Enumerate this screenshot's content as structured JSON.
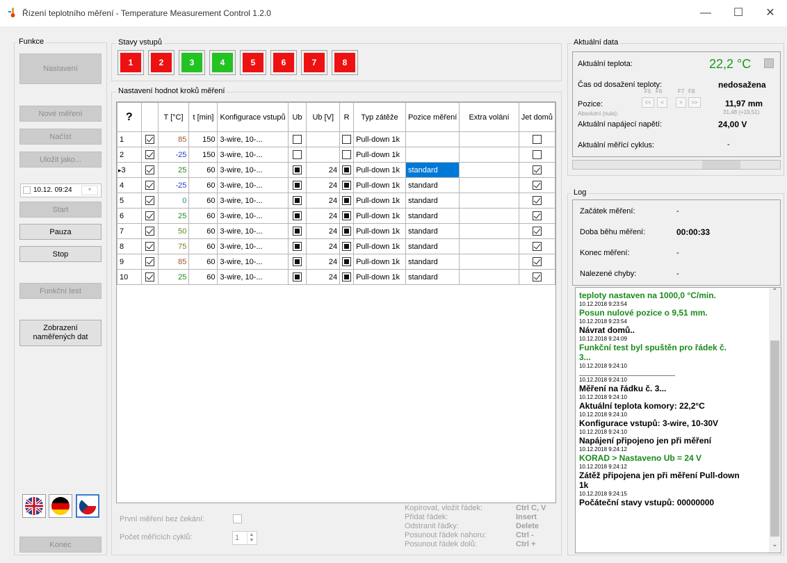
{
  "window": {
    "title": "Řízení teplotního měření - Temperature Measurement Control 1.2.0",
    "minimize": "—",
    "maximize": "☐",
    "close": "✕"
  },
  "funkce": {
    "title": "Funkce",
    "nastaveni": "Nastavení",
    "nove_mereni": "Nové měření",
    "nacist": "Načíst",
    "ulozit_jako": "Uložit jako...",
    "datetime_value": "10.12. 09:24",
    "start": "Start",
    "pauza": "Pauza",
    "stop": "Stop",
    "funkcni_test": "Funkční test",
    "zobrazeni_line1": "Zobrazení",
    "zobrazeni_line2": "naměřených dat",
    "konec": "Konec"
  },
  "stavy": {
    "title": "Stavy vstupů",
    "items": [
      {
        "label": "1",
        "color": "#ee1111"
      },
      {
        "label": "2",
        "color": "#ee1111"
      },
      {
        "label": "3",
        "color": "#22c322"
      },
      {
        "label": "4",
        "color": "#22c322"
      },
      {
        "label": "5",
        "color": "#ee1111"
      },
      {
        "label": "6",
        "color": "#ee1111"
      },
      {
        "label": "7",
        "color": "#ee1111"
      },
      {
        "label": "8",
        "color": "#ee1111"
      }
    ]
  },
  "kroky": {
    "title": "Nastavení hodnot kroků měření",
    "columns": [
      "?",
      "",
      "T [°C]",
      "t [min]",
      "Konfigurace vstupů",
      "Ub",
      "Ub [V]",
      "R",
      "Typ zátěže",
      "Pozice měření",
      "Extra volání",
      "Jet domů"
    ],
    "rows": [
      {
        "n": "1",
        "en": true,
        "t": "85",
        "tcol": "#a0522d",
        "min": "150",
        "konf": "3-wire, 10-...",
        "ub": "empty",
        "ubv": "",
        "r": "empty",
        "typ": "Pull-down 1k",
        "poz": "",
        "extra": "",
        "domu": "empty",
        "current": false
      },
      {
        "n": "2",
        "en": true,
        "t": "-25",
        "tcol": "#1f3fbf",
        "min": "150",
        "konf": "3-wire, 10-...",
        "ub": "empty",
        "ubv": "",
        "r": "empty",
        "typ": "Pull-down 1k",
        "poz": "",
        "extra": "",
        "domu": "empty",
        "current": false
      },
      {
        "n": "3",
        "en": true,
        "t": "25",
        "tcol": "#1a8a1a",
        "min": "60",
        "konf": "3-wire, 10-...",
        "ub": "ind",
        "ubv": "24",
        "r": "ind",
        "typ": "Pull-down 1k",
        "poz": "standard",
        "extra": "",
        "domu": "chk",
        "current": true
      },
      {
        "n": "4",
        "en": true,
        "t": "-25",
        "tcol": "#1f3fbf",
        "min": "60",
        "konf": "3-wire, 10-...",
        "ub": "ind",
        "ubv": "24",
        "r": "ind",
        "typ": "Pull-down 1k",
        "poz": "standard",
        "extra": "",
        "domu": "chk",
        "current": false
      },
      {
        "n": "5",
        "en": true,
        "t": "0",
        "tcol": "#1a8a8a",
        "min": "60",
        "konf": "3-wire, 10-...",
        "ub": "ind",
        "ubv": "24",
        "r": "ind",
        "typ": "Pull-down 1k",
        "poz": "standard",
        "extra": "",
        "domu": "chk",
        "current": false
      },
      {
        "n": "6",
        "en": true,
        "t": "25",
        "tcol": "#1a8a1a",
        "min": "60",
        "konf": "3-wire, 10-...",
        "ub": "ind",
        "ubv": "24",
        "r": "ind",
        "typ": "Pull-down 1k",
        "poz": "standard",
        "extra": "",
        "domu": "chk",
        "current": false
      },
      {
        "n": "7",
        "en": true,
        "t": "50",
        "tcol": "#5a8a1a",
        "min": "60",
        "konf": "3-wire, 10-...",
        "ub": "ind",
        "ubv": "24",
        "r": "ind",
        "typ": "Pull-down 1k",
        "poz": "standard",
        "extra": "",
        "domu": "chk",
        "current": false
      },
      {
        "n": "8",
        "en": true,
        "t": "75",
        "tcol": "#8a7a1a",
        "min": "60",
        "konf": "3-wire, 10-...",
        "ub": "ind",
        "ubv": "24",
        "r": "ind",
        "typ": "Pull-down 1k",
        "poz": "standard",
        "extra": "",
        "domu": "chk",
        "current": false
      },
      {
        "n": "9",
        "en": true,
        "t": "85",
        "tcol": "#a0522d",
        "min": "60",
        "konf": "3-wire, 10-...",
        "ub": "ind",
        "ubv": "24",
        "r": "ind",
        "typ": "Pull-down 1k",
        "poz": "standard",
        "extra": "",
        "domu": "chk",
        "current": false
      },
      {
        "n": "10",
        "en": true,
        "t": "25",
        "tcol": "#1a8a1a",
        "min": "60",
        "konf": "3-wire, 10-...",
        "ub": "ind",
        "ubv": "24",
        "r": "ind",
        "typ": "Pull-down 1k",
        "poz": "standard",
        "extra": "",
        "domu": "chk",
        "current": false
      }
    ],
    "prvni_mereni_label": "První měření bez čekání:",
    "pocet_cyklu_label": "Počet měřících cyklů:",
    "pocet_cyklu_value": "1",
    "shortcuts": [
      {
        "label": "Kopírovat, vložit řádek:",
        "key": "Ctrl C, V"
      },
      {
        "label": "Přidat řádek:",
        "key": "Insert"
      },
      {
        "label": "Odstranit řádky:",
        "key": "Delete"
      },
      {
        "label": "Posunout řádek nahoru:",
        "key": "Ctrl -"
      },
      {
        "label": "Posunout řádek dolů:",
        "key": "Ctrl +"
      }
    ]
  },
  "aktualni": {
    "title": "Aktuální data",
    "teplota_label": "Aktuální teplota:",
    "teplota_value": "22,2 °C",
    "teplota_color": "#1a9a1a",
    "cas_label": "Čas od dosažení teploty:",
    "cas_value": "nedosažena",
    "pozice_label": "Pozice:",
    "pozice_sub": "Absolutní (nula):",
    "fkeys": [
      "F5",
      "F6",
      "F7",
      "F8"
    ],
    "nav": [
      "<<",
      "<",
      ">",
      ">>"
    ],
    "pozice_value": "11,97 mm",
    "pozice_abs": "31,48 (+19,51)",
    "napeti_label": "Aktuální napájecí napětí:",
    "napeti_value": "24,00 V",
    "cyklus_label": "Aktuální měřící cyklus:",
    "cyklus_value": "-"
  },
  "log": {
    "title": "Log",
    "zacatek_label": "Začátek měření:",
    "zacatek_value": "-",
    "doba_label": "Doba běhu měření:",
    "doba_value": "00:00:33",
    "konec_label": "Konec měření:",
    "konec_value": "-",
    "chyby_label": "Nalezené chyby:",
    "chyby_value": "-",
    "entries": [
      {
        "type": "msg",
        "text": "teploty nastaven na 1000,0 °C/min.",
        "green": true
      },
      {
        "type": "ts",
        "text": "10.12.2018 9:23:54"
      },
      {
        "type": "msg",
        "text": "Posun nulové pozice o 9,51 mm.",
        "green": true
      },
      {
        "type": "ts",
        "text": "10.12.2018 9:23:54"
      },
      {
        "type": "msg",
        "text": "Návrat domů..",
        "green": false
      },
      {
        "type": "ts",
        "text": "10.12.2018 9:24:09"
      },
      {
        "type": "msg",
        "text": "Funkční test byl spuštěn pro řádek č.",
        "green": true
      },
      {
        "type": "msg",
        "text": "3...",
        "green": true
      },
      {
        "type": "ts",
        "text": "10.12.2018 9:24:10"
      },
      {
        "type": "sep",
        "text": "_______________________________"
      },
      {
        "type": "ts",
        "text": "10.12.2018 9:24:10"
      },
      {
        "type": "msg",
        "text": "Měření na řádku č. 3...",
        "green": false
      },
      {
        "type": "ts",
        "text": "10.12.2018 9:24:10"
      },
      {
        "type": "msg",
        "text": "Aktuální teplota komory: 22,2°C",
        "green": false
      },
      {
        "type": "ts",
        "text": "10.12.2018 9:24:10"
      },
      {
        "type": "msg",
        "text": "Konfigurace vstupů: 3-wire, 10-30V",
        "green": false
      },
      {
        "type": "ts",
        "text": "10.12.2018 9:24:10"
      },
      {
        "type": "msg",
        "text": "Napájení připojeno jen při měření",
        "green": false
      },
      {
        "type": "ts",
        "text": "10.12.2018 9:24:12"
      },
      {
        "type": "msg",
        "text": "KORAD > Nastaveno Ub = 24 V",
        "green": true
      },
      {
        "type": "ts",
        "text": "10.12.2018 9:24:12"
      },
      {
        "type": "msg",
        "text": "Zátěž připojena jen při měření Pull-down",
        "green": false
      },
      {
        "type": "msg",
        "text": "1k",
        "green": false
      },
      {
        "type": "ts",
        "text": "10.12.2018 9:24:15"
      },
      {
        "type": "msg",
        "text": "Počáteční stavy vstupů: 00000000",
        "green": false
      }
    ]
  }
}
